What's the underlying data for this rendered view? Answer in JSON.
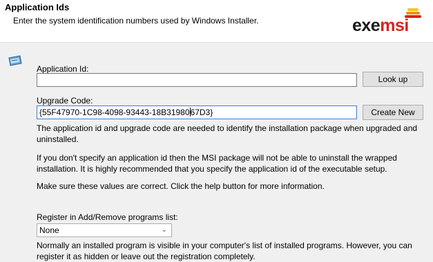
{
  "header": {
    "title": "Application Ids",
    "subtitle": "Enter the system identification numbers used by Windows Installer.",
    "logo": {
      "part1": "exe",
      "part2": "msi",
      "accent": "#d9241b",
      "bar_colors": [
        "#d9241b",
        "#f08a24",
        "#f5c518"
      ]
    }
  },
  "app_id": {
    "label": "Application Id:",
    "value": "",
    "button": "Look up"
  },
  "upgrade_code": {
    "label": "Upgrade Code:",
    "value_before_caret": "{55F47970-1C98-4098-93443-18B31980",
    "value_after_caret": "67D3}",
    "button": "Create New"
  },
  "paragraphs": {
    "p1": "The application id and upgrade code are needed to identify the installation package when upgraded and uninstalled.",
    "p2": "If you don't specify an application id then the MSI package will not be able to uninstall the wrapped installation. It is highly recommended that you specify the application id of the executable setup.",
    "p3": "Make sure these values are correct. Click the help button for more information."
  },
  "register": {
    "label": "Register in Add/Remove programs list:",
    "selected": "None",
    "note": "Normally an installed program is visible in your computer's list of installed programs. However, you can register it as hidden or leave out the registration completely."
  },
  "icons": {
    "wizard": "setup-package-icon",
    "dropdown": "chevron-down-icon"
  }
}
